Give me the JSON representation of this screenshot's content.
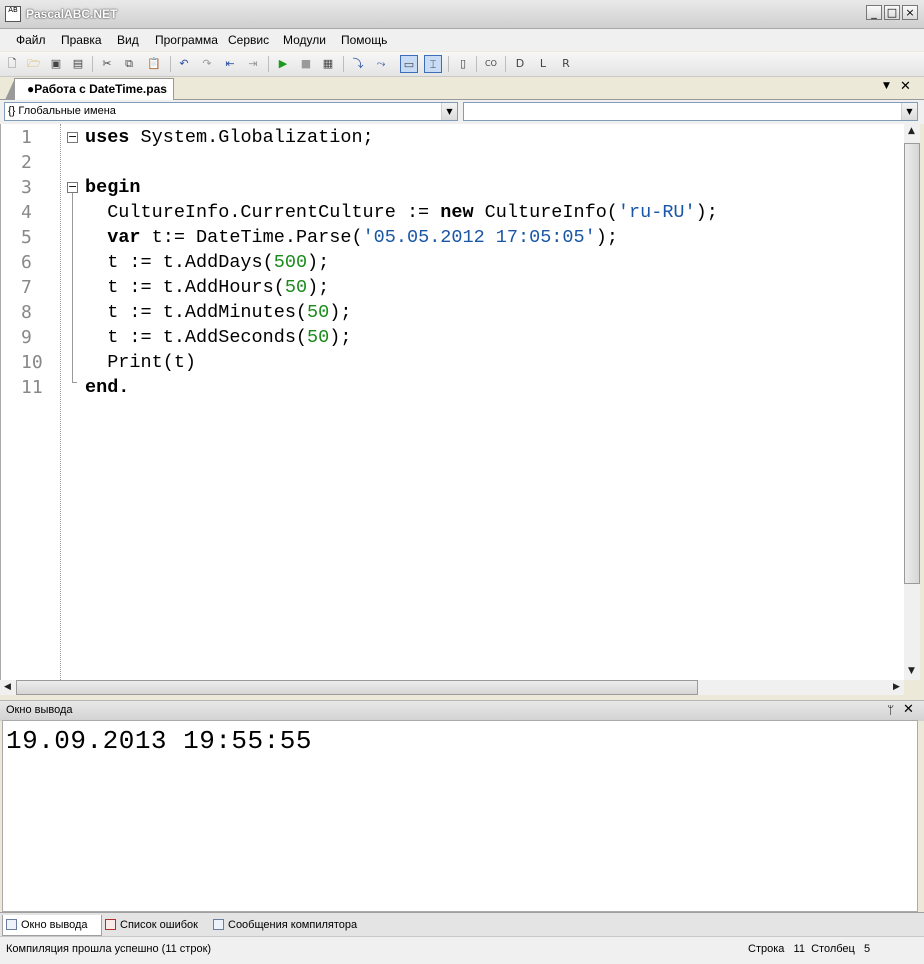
{
  "window": {
    "title": "PascalABC.NET",
    "icon_text": "AB",
    "minimize": "_",
    "maximize": "□",
    "close": "×"
  },
  "menu": [
    "Файл",
    "Правка",
    "Вид",
    "Программа",
    "Сервис",
    "Модули",
    "Помощь"
  ],
  "toolbar_icons": [
    "new-file-icon",
    "open-icon",
    "save-icon",
    "save-all-icon",
    "cut-icon",
    "copy-icon",
    "paste-icon",
    "undo-icon",
    "redo-icon",
    "indent-icon",
    "outdent-icon",
    "run-icon",
    "stop-icon",
    "compile-icon",
    "step-into-icon",
    "step-over-icon",
    "toggle-view-icon",
    "toggle-mode-icon",
    "find-icon",
    "code-template-icon",
    "format-d-icon",
    "format-l-icon",
    "format-r-icon"
  ],
  "tab": {
    "label": "●Работа с DateTime.pas",
    "menu": "▼",
    "close": "✕"
  },
  "navbar": {
    "scope": "{} Глобальные имена",
    "member": ""
  },
  "editor": {
    "line_numbers": [
      "1",
      "2",
      "3",
      "4",
      "5",
      "6",
      "7",
      "8",
      "9",
      "10",
      "11"
    ],
    "lines": [
      [
        {
          "t": "uses",
          "c": "kw"
        },
        {
          "t": " System.Globalization;",
          "c": ""
        }
      ],
      [],
      [
        {
          "t": "begin",
          "c": "kw"
        }
      ],
      [
        {
          "t": "  CultureInfo.CurrentCulture := ",
          "c": ""
        },
        {
          "t": "new",
          "c": "kw"
        },
        {
          "t": " CultureInfo(",
          "c": ""
        },
        {
          "t": "'ru-RU'",
          "c": "str"
        },
        {
          "t": ");",
          "c": ""
        }
      ],
      [
        {
          "t": "  ",
          "c": ""
        },
        {
          "t": "var",
          "c": "kw"
        },
        {
          "t": " t:= DateTime.Parse(",
          "c": ""
        },
        {
          "t": "'05.05.2012 17:05:05'",
          "c": "str"
        },
        {
          "t": ");",
          "c": ""
        }
      ],
      [
        {
          "t": "  t := t.AddDays(",
          "c": ""
        },
        {
          "t": "500",
          "c": "num"
        },
        {
          "t": ");",
          "c": ""
        }
      ],
      [
        {
          "t": "  t := t.AddHours(",
          "c": ""
        },
        {
          "t": "50",
          "c": "num"
        },
        {
          "t": ");",
          "c": ""
        }
      ],
      [
        {
          "t": "  t := t.AddMinutes(",
          "c": ""
        },
        {
          "t": "50",
          "c": "num"
        },
        {
          "t": ");",
          "c": ""
        }
      ],
      [
        {
          "t": "  t := t.AddSeconds(",
          "c": ""
        },
        {
          "t": "50",
          "c": "num"
        },
        {
          "t": ");",
          "c": ""
        }
      ],
      [
        {
          "t": "  Print(t)",
          "c": ""
        }
      ],
      [
        {
          "t": "end.",
          "c": "kw"
        }
      ]
    ]
  },
  "output": {
    "title": "Окно вывода",
    "pin": "ᛘ",
    "close": "✕",
    "text": "19.09.2013 19:55:55"
  },
  "bottom_tabs": [
    "Окно вывода",
    "Список ошибок",
    "Сообщения компилятора"
  ],
  "status": {
    "message": "Компиляция прошла успешно (11 строк)",
    "position": "Строка   11  Столбец   5"
  }
}
